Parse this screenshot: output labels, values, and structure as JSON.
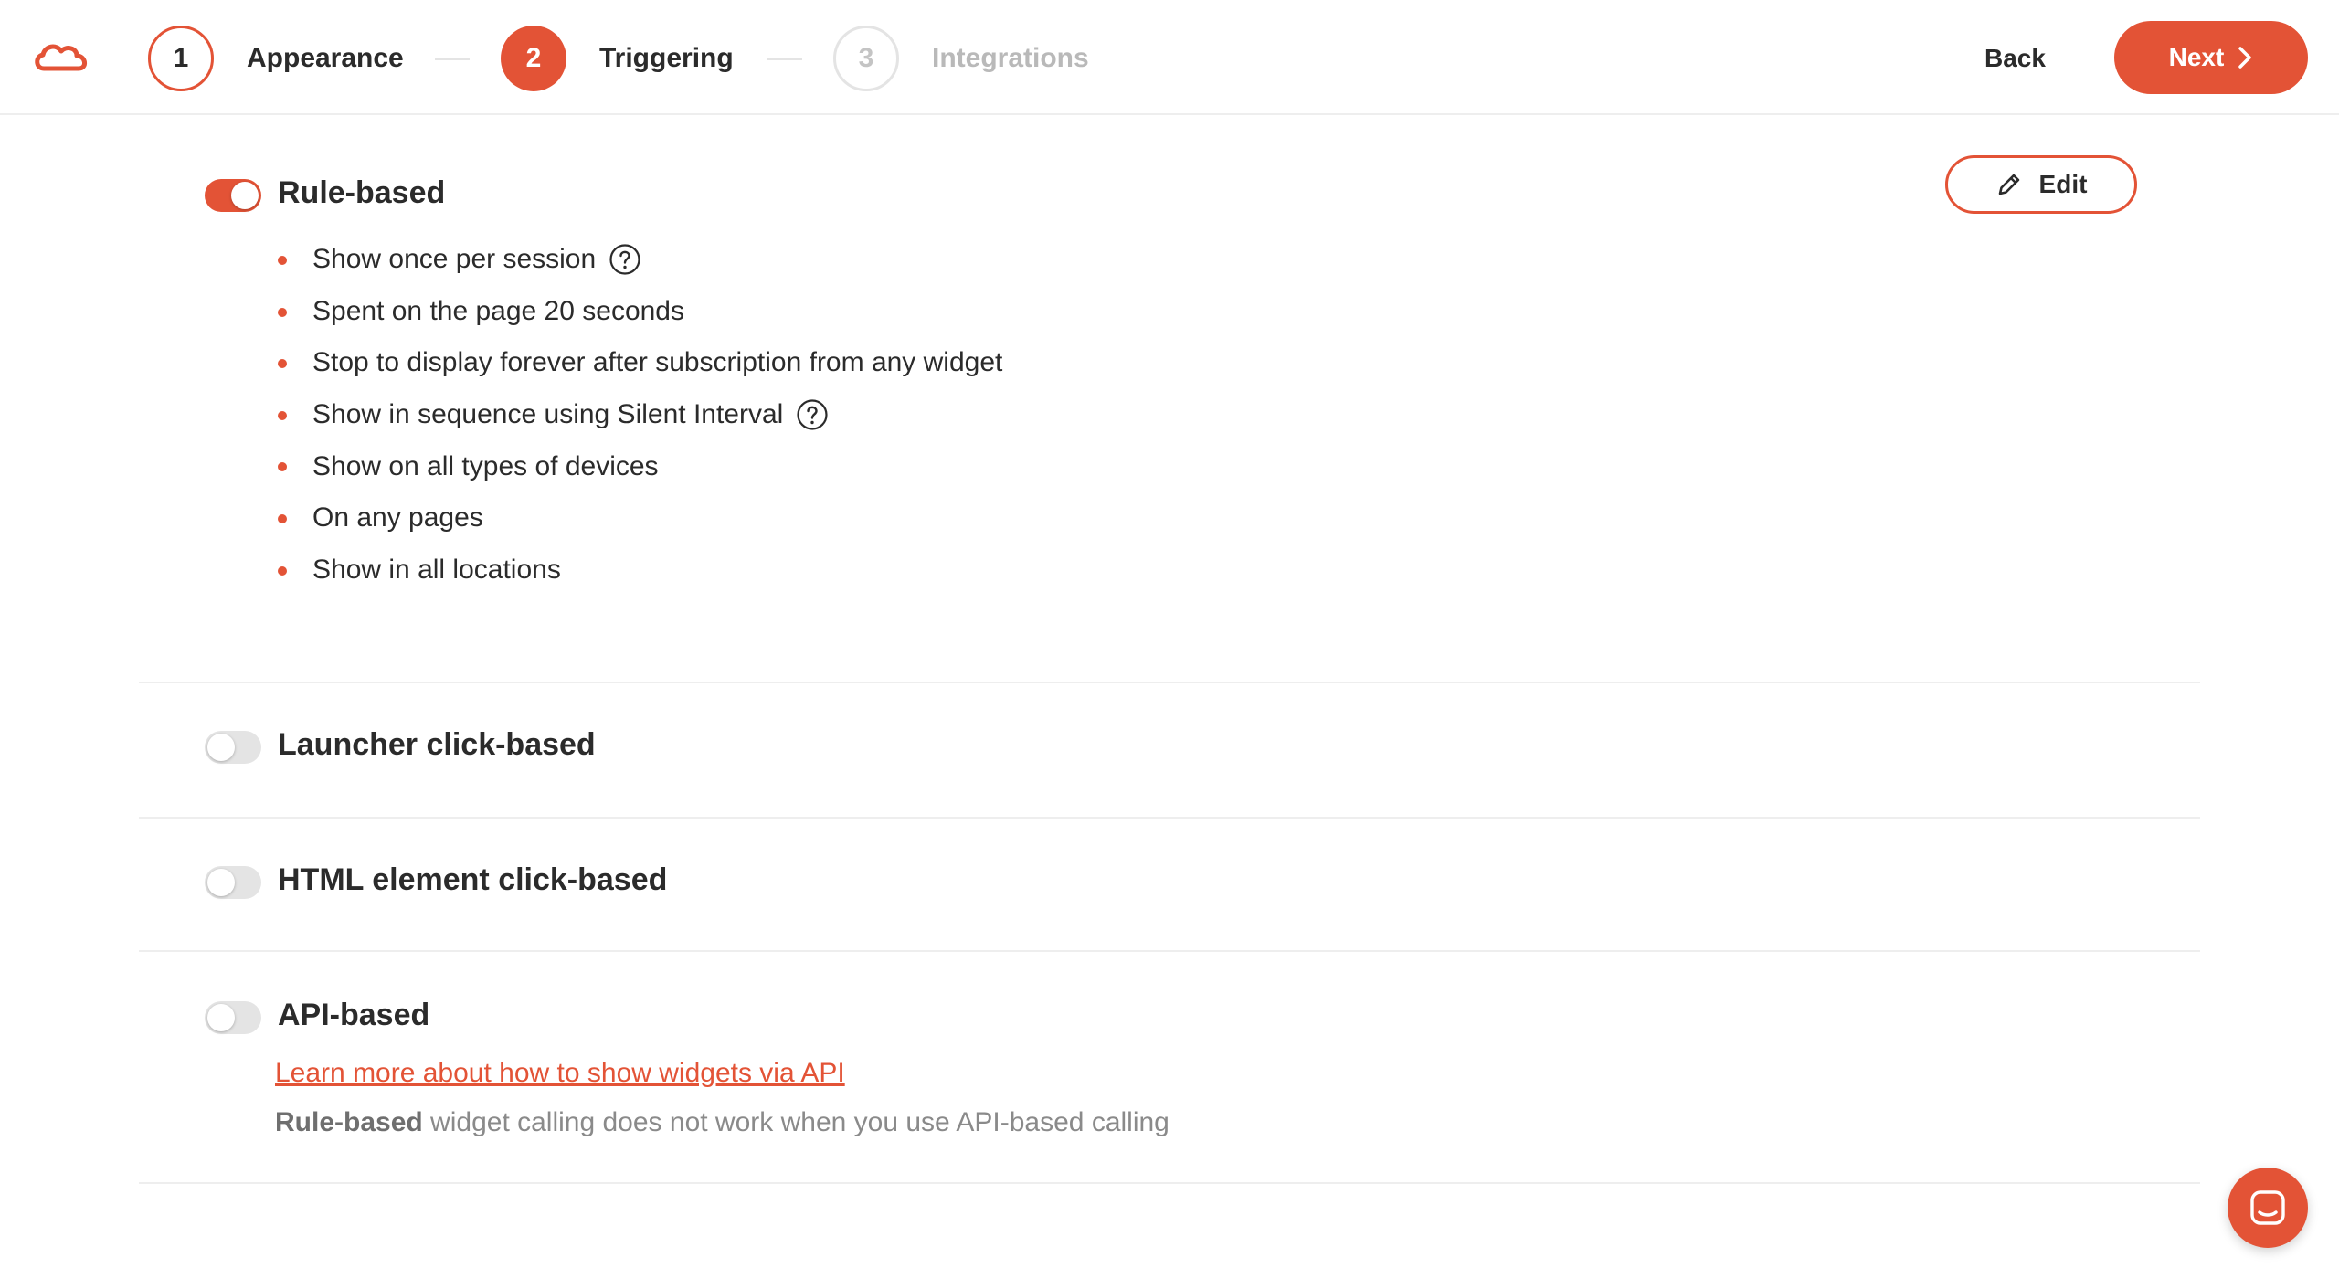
{
  "colors": {
    "accent": "#e35336",
    "text": "#2b2b2b",
    "muted": "#8a8a8a",
    "inactive": "#b9b9b9"
  },
  "header": {
    "logo": "cloud-logo-icon",
    "steps": [
      {
        "number": "1",
        "label": "Appearance",
        "state": "completed"
      },
      {
        "number": "2",
        "label": "Triggering",
        "state": "active"
      },
      {
        "number": "3",
        "label": "Integrations",
        "state": "inactive"
      }
    ],
    "back_label": "Back",
    "next_label": "Next"
  },
  "sections": {
    "rule_based": {
      "title": "Rule-based",
      "enabled": true,
      "edit_label": "Edit",
      "rules": [
        {
          "text": "Show once per session",
          "help": true
        },
        {
          "text": "Spent on the page 20 seconds",
          "help": false
        },
        {
          "text": "Stop to display forever after subscription from any widget",
          "help": false
        },
        {
          "text": "Show in sequence using Silent Interval",
          "help": true
        },
        {
          "text": "Show on all types of devices",
          "help": false
        },
        {
          "text": "On any pages",
          "help": false
        },
        {
          "text": "Show in all locations",
          "help": false
        }
      ]
    },
    "launcher_click": {
      "title": "Launcher click-based",
      "enabled": false
    },
    "html_element_click": {
      "title": "HTML element click-based",
      "enabled": false
    },
    "api_based": {
      "title": "API-based",
      "enabled": false,
      "link_text": "Learn more about how to show widgets via API",
      "note_bold": "Rule-based",
      "note_rest": " widget calling does not work when you use API-based calling"
    }
  },
  "chat": {
    "icon": "chat-icon"
  }
}
